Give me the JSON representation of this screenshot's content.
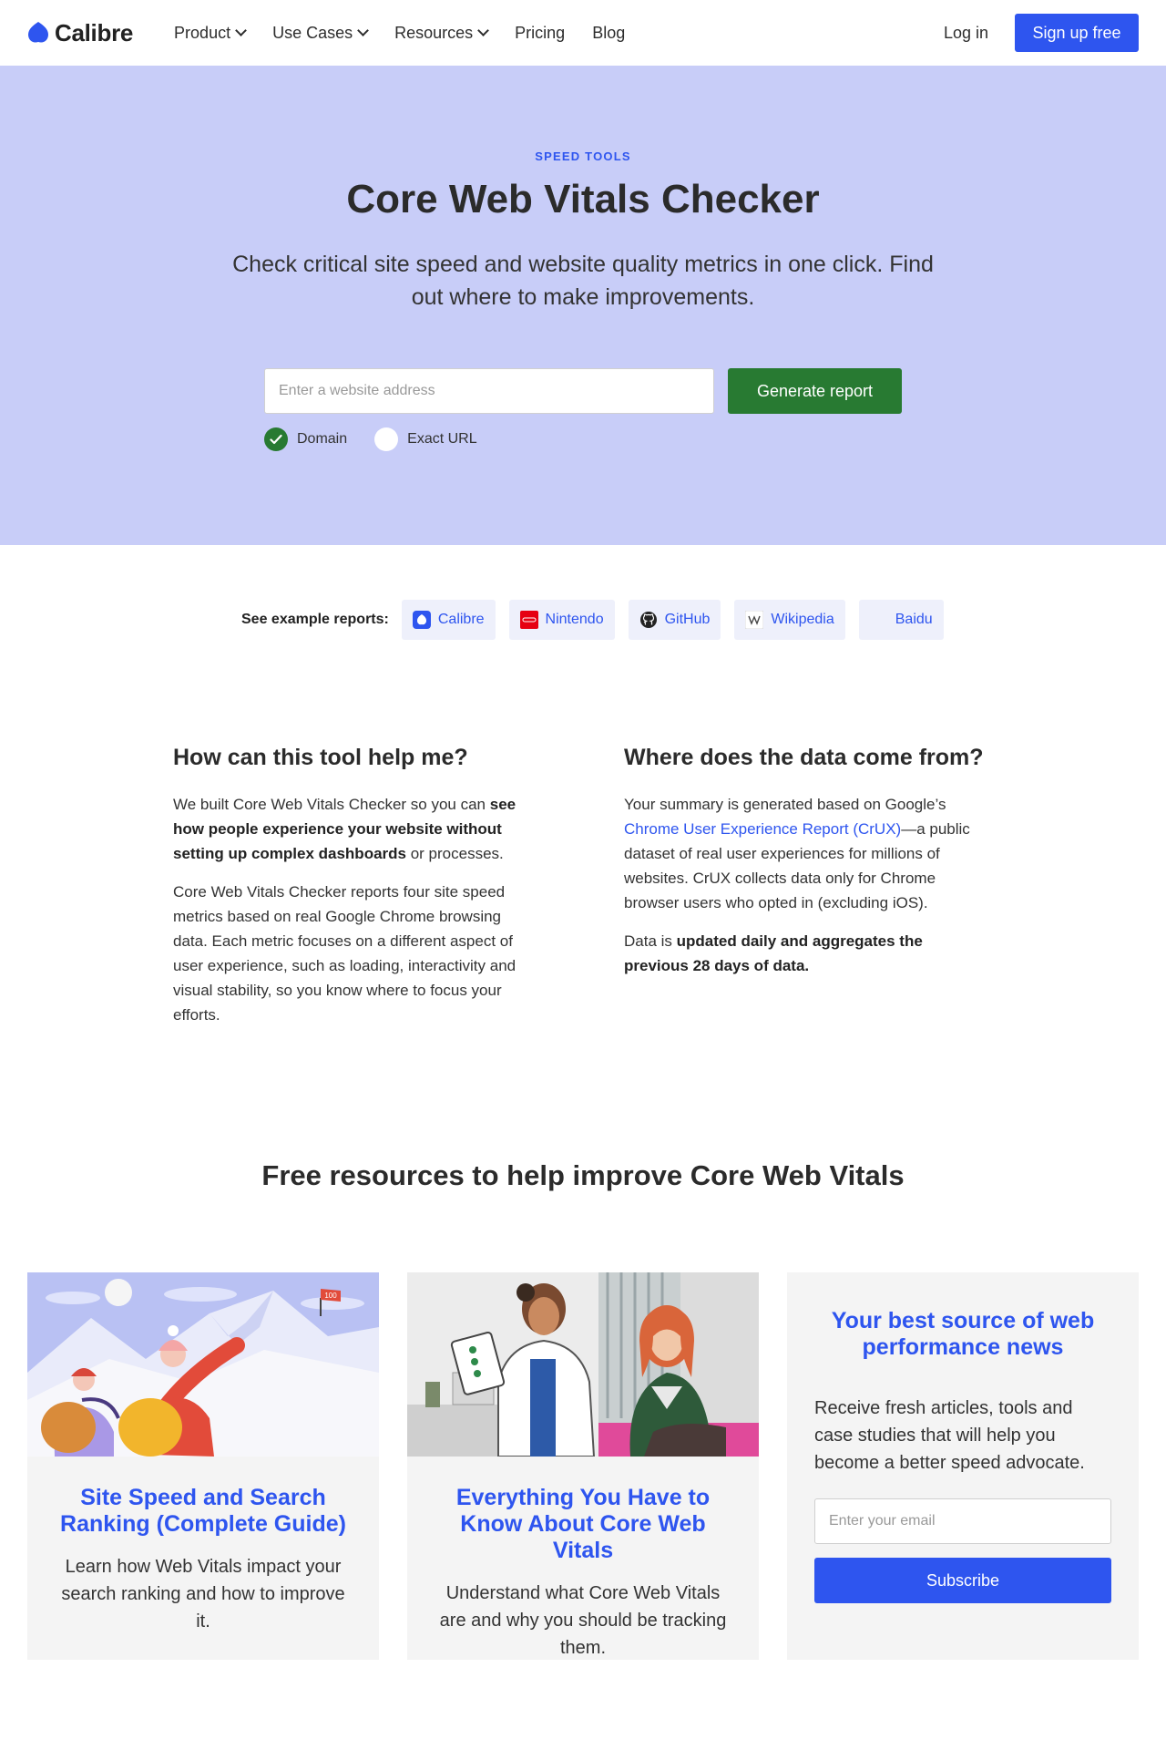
{
  "nav": {
    "logo_text": "Calibre",
    "links": [
      {
        "label": "Product",
        "dropdown": true
      },
      {
        "label": "Use Cases",
        "dropdown": true
      },
      {
        "label": "Resources",
        "dropdown": true
      },
      {
        "label": "Pricing",
        "dropdown": false
      },
      {
        "label": "Blog",
        "dropdown": false
      }
    ],
    "login": "Log in",
    "signup": "Sign up free"
  },
  "hero": {
    "eyebrow": "SPEED TOOLS",
    "title": "Core Web Vitals Checker",
    "subtitle": "Check critical site speed and website quality metrics in one click. Find out where to make improvements.",
    "input_placeholder": "Enter a website address",
    "button": "Generate report",
    "options": [
      {
        "label": "Domain",
        "selected": true
      },
      {
        "label": "Exact URL",
        "selected": false
      }
    ]
  },
  "examples": {
    "label": "See example reports:",
    "items": [
      {
        "label": "Calibre",
        "icon": "calibre-logo-icon"
      },
      {
        "label": "Nintendo",
        "icon": "nintendo-logo-icon"
      },
      {
        "label": "GitHub",
        "icon": "github-logo-icon"
      },
      {
        "label": "Wikipedia",
        "icon": "wikipedia-logo-icon"
      },
      {
        "label": "Baidu",
        "icon": "baidu-logo-icon"
      }
    ]
  },
  "info": {
    "left": {
      "title": "How can this tool help me?",
      "p1_a": "We built Core Web Vitals Checker so you can ",
      "p1_b": "see how people experience your website without setting up complex dashboards",
      "p1_c": " or processes.",
      "p2": "Core Web Vitals Checker reports four site speed metrics based on real Google Chrome browsing data. Each metric focuses on a different aspect of user experience, such as loading, interactivity and visual stability, so you know where to focus your efforts."
    },
    "right": {
      "title": "Where does the data come from?",
      "p1_a": "Your summary is generated based on Google’s ",
      "p1_link": "Chrome User Experience Report (CrUX)",
      "p1_b": "—a public dataset of real user experiences for millions of websites. CrUX collects data only for Chrome browser users who opted in (excluding iOS).",
      "p2_a": "Data is ",
      "p2_b": "updated daily and aggregates the previous 28 days of data."
    }
  },
  "resources": {
    "title": "Free resources to help improve Core Web Vitals",
    "cards": [
      {
        "title": "Site Speed and Search Ranking (Complete Guide)",
        "desc": "Learn how Web Vitals impact your search ranking and how to improve it."
      },
      {
        "title": "Everything You Have to Know About Core Web Vitals",
        "desc": "Understand what Core Web Vitals are and why you should be tracking them."
      }
    ],
    "news": {
      "title": "Your best source of web performance news",
      "desc": "Receive fresh articles, tools and case studies that will help you become a better speed advocate.",
      "email_placeholder": "Enter your email",
      "button": "Subscribe"
    },
    "flag_text": "100"
  },
  "colors": {
    "accent": "#2e55ef",
    "hero_bg": "#c8cdf8",
    "primary_green": "#287a32"
  }
}
